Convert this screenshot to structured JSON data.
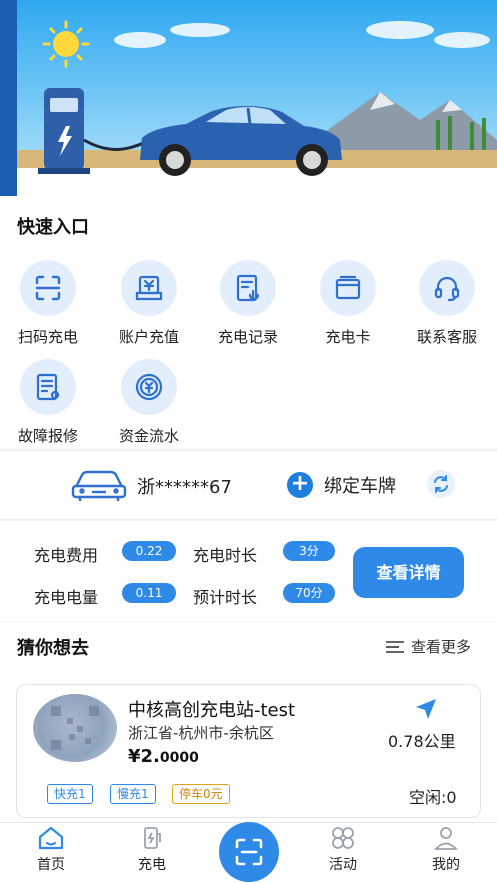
{
  "banner": {
    "slide_count": 4,
    "active_index": 0
  },
  "quick_entry": {
    "title": "快速入口",
    "items": [
      {
        "label": "扫码充电",
        "icon": "scan-icon"
      },
      {
        "label": "账户充值",
        "icon": "yuan-wallet-icon"
      },
      {
        "label": "充电记录",
        "icon": "charge-record-icon"
      },
      {
        "label": "充电卡",
        "icon": "card-icon"
      },
      {
        "label": "联系客服",
        "icon": "headset-icon"
      },
      {
        "label": "故障报修",
        "icon": "repair-report-icon"
      },
      {
        "label": "资金流水",
        "icon": "money-flow-icon"
      }
    ]
  },
  "vehicle": {
    "plate": "浙******67",
    "bind_label": "绑定车牌"
  },
  "charging_info": {
    "fee_label": "充电费用",
    "fee_value": "0.22元",
    "duration_label": "充电时长",
    "duration_value": "3分",
    "energy_label": "充电电量",
    "energy_value": "0.11度",
    "est_label": "预计时长",
    "est_value": "70分",
    "detail_button": "查看详情"
  },
  "guess": {
    "title": "猜你想去",
    "more_label": "查看更多",
    "station": {
      "name": "中核高创充电站-test",
      "address": "浙江省-杭州市-余杭区",
      "price_symbol": "¥",
      "price_int": "2.",
      "price_dec": "0000",
      "distance": "0.78公里",
      "idle": "空闲:0",
      "tags": [
        "快充1",
        "慢充1",
        "停车0元"
      ]
    }
  },
  "bottom_nav": [
    {
      "label": "首页",
      "icon": "home-icon"
    },
    {
      "label": "充电",
      "icon": "charger-icon"
    },
    {
      "label": "",
      "icon": "scan-icon"
    },
    {
      "label": "活动",
      "icon": "clover-icon"
    },
    {
      "label": "我的",
      "icon": "user-icon"
    }
  ],
  "colors": {
    "accent": "#2e8ae6",
    "icon_bg": "#e3eefc",
    "park_tag": "#e0a21a"
  }
}
